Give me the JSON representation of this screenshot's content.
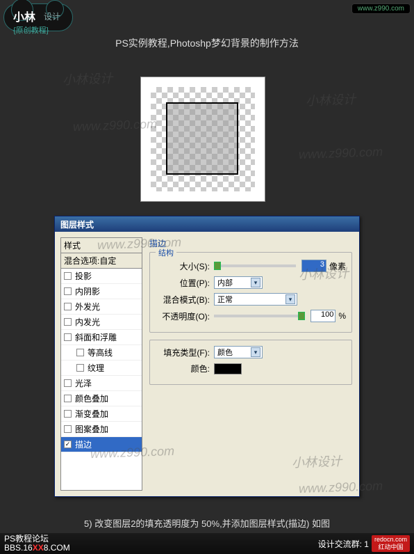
{
  "logo": {
    "main": "小林",
    "sub": "设计",
    "subtitle": "{原创教程}"
  },
  "url_badge": "www.z990.com",
  "page_title": "PS实例教程,Photoshp梦幻背景的制作方法",
  "watermark_text": "小林设计",
  "watermark_url": "www.z990.com",
  "dialog": {
    "title": "图层样式",
    "styles_header": "样式",
    "blend_options": "混合选项:自定",
    "items": [
      {
        "label": "投影",
        "checked": false,
        "indent": false
      },
      {
        "label": "内阴影",
        "checked": false,
        "indent": false
      },
      {
        "label": "外发光",
        "checked": false,
        "indent": false
      },
      {
        "label": "内发光",
        "checked": false,
        "indent": false
      },
      {
        "label": "斜面和浮雕",
        "checked": false,
        "indent": false
      },
      {
        "label": "等高线",
        "checked": false,
        "indent": true
      },
      {
        "label": "纹理",
        "checked": false,
        "indent": true
      },
      {
        "label": "光泽",
        "checked": false,
        "indent": false
      },
      {
        "label": "颜色叠加",
        "checked": false,
        "indent": false
      },
      {
        "label": "渐变叠加",
        "checked": false,
        "indent": false
      },
      {
        "label": "图案叠加",
        "checked": false,
        "indent": false
      },
      {
        "label": "描边",
        "checked": true,
        "indent": false,
        "active": true
      }
    ],
    "stroke": {
      "section": "描边",
      "structure": "结构",
      "size_label": "大小(S):",
      "size_value": "3",
      "size_unit": "像素",
      "position_label": "位置(P):",
      "position_value": "内部",
      "blend_label": "混合模式(B):",
      "blend_value": "正常",
      "opacity_label": "不透明度(O):",
      "opacity_value": "100",
      "opacity_unit": "%",
      "fill_type_label": "填充类型(F):",
      "fill_type_value": "颜色",
      "color_label": "颜色:",
      "color_value": "#000000"
    }
  },
  "caption": "5) 改变图层2的填充透明度为 50%,并添加图层样式(描边) 如图",
  "footer": {
    "line1": "PS教程论坛",
    "bbs_pre": "BBS.16",
    "bbs_mid": "XX",
    "bbs_post": "8.COM",
    "group": "设计交流群: 1",
    "redocn1": "redocn.com",
    "redocn2": "红动中国"
  }
}
